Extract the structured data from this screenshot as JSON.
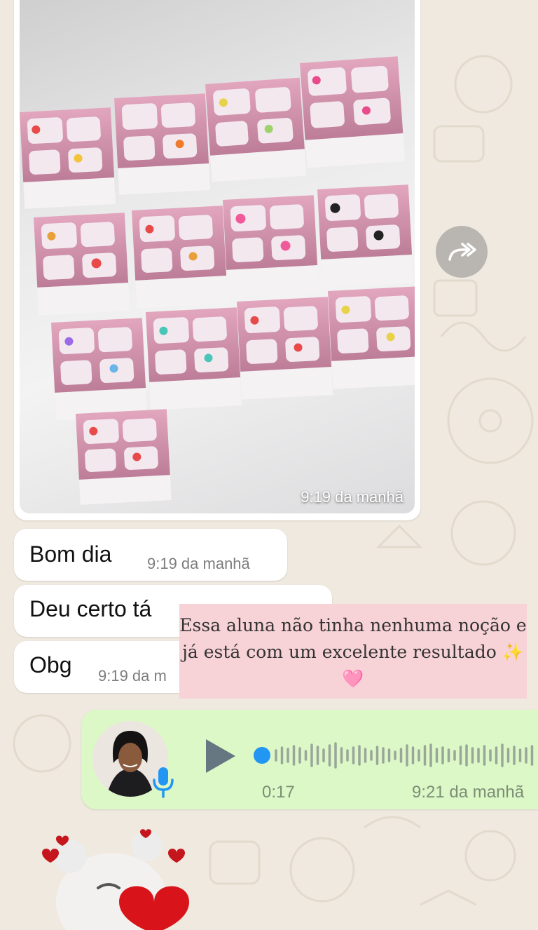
{
  "chat": {
    "image_message": {
      "time": "9:19 da manhã"
    },
    "messages": [
      {
        "text": "Bom dia",
        "time": "9:19 da manhã"
      },
      {
        "text": "Deu certo tá",
        "time": ""
      },
      {
        "text": "Obg",
        "time": "9:19 da m"
      }
    ],
    "voice_message": {
      "duration": "0:17",
      "time": "9:21 da manhã",
      "progress": 0
    }
  },
  "overlay": {
    "caption": "Essa aluna não tinha nenhuma noção e já está com um excelente resultado ✨🩷"
  },
  "colors": {
    "chat_background": "#efe9df",
    "incoming_bubble": "#ffffff",
    "outgoing_bubble": "#dcf8c6",
    "caption_background": "#f7d2d6",
    "voice_accent": "#2196f3"
  },
  "icons": [
    "forward-icon",
    "play-icon",
    "microphone-icon"
  ]
}
